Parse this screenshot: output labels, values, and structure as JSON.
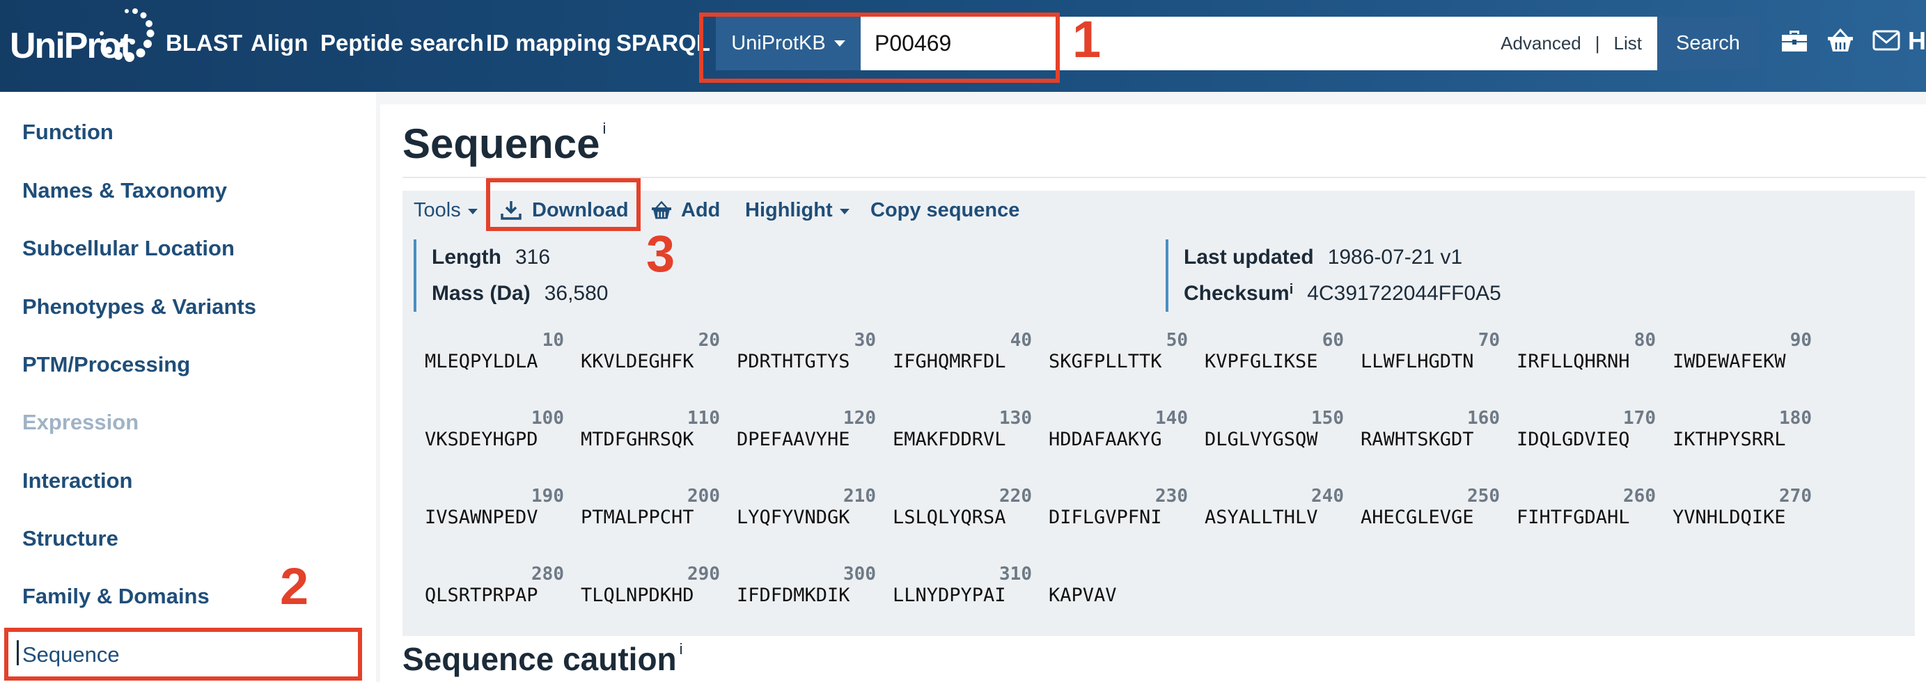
{
  "header": {
    "logo_text": "UniProt",
    "nav": [
      "BLAST",
      "Align",
      "Peptide search",
      "ID mapping",
      "SPARQL"
    ],
    "db_select": "UniProtKB",
    "search_value": "P00469",
    "advanced_label": "Advanced",
    "separator": "|",
    "list_label": "List",
    "search_button": "Search",
    "icons": [
      "toolbox-icon",
      "basket-icon",
      "mail-icon"
    ],
    "trailing_text": "H"
  },
  "sidebar": {
    "items": [
      {
        "label": "Function",
        "state": "normal"
      },
      {
        "label": "Names & Taxonomy",
        "state": "normal"
      },
      {
        "label": "Subcellular Location",
        "state": "normal"
      },
      {
        "label": "Phenotypes & Variants",
        "state": "normal"
      },
      {
        "label": "PTM/Processing",
        "state": "normal"
      },
      {
        "label": "Expression",
        "state": "disabled"
      },
      {
        "label": "Interaction",
        "state": "normal"
      },
      {
        "label": "Structure",
        "state": "normal"
      },
      {
        "label": "Family & Domains",
        "state": "normal"
      },
      {
        "label": "Sequence",
        "state": "active"
      }
    ]
  },
  "main": {
    "title": "Sequence",
    "title_sup": "i",
    "toolbar": {
      "tools": "Tools",
      "download": "Download",
      "add": "Add",
      "highlight": "Highlight",
      "copy": "Copy sequence"
    },
    "info_left": [
      {
        "label": "Length",
        "value": "316"
      },
      {
        "label": "Mass (Da)",
        "value": "36,580"
      }
    ],
    "info_right": [
      {
        "label": "Last updated",
        "sup": "",
        "value": "1986-07-21 v1"
      },
      {
        "label": "Checksum",
        "sup": "i",
        "value": "4C391722044FF0A5"
      }
    ],
    "sequence_chunks": [
      {
        "num": "10",
        "aa": "MLEQPYLDLA"
      },
      {
        "num": "20",
        "aa": "KKVLDEGHFK"
      },
      {
        "num": "30",
        "aa": "PDRTHTGTYS"
      },
      {
        "num": "40",
        "aa": "IFGHQMRFDL"
      },
      {
        "num": "50",
        "aa": "SKGFPLLTTK"
      },
      {
        "num": "60",
        "aa": "KVPFGLIKSE"
      },
      {
        "num": "70",
        "aa": "LLWFLHGDTN"
      },
      {
        "num": "80",
        "aa": "IRFLLQHRNH"
      },
      {
        "num": "90",
        "aa": "IWDEWAFEKW"
      },
      {
        "num": "100",
        "aa": "VKSDEYHGPD"
      },
      {
        "num": "110",
        "aa": "MTDFGHRSQK"
      },
      {
        "num": "120",
        "aa": "DPEFAAVYHE"
      },
      {
        "num": "130",
        "aa": "EMAKFDDRVL"
      },
      {
        "num": "140",
        "aa": "HDDAFAAKYG"
      },
      {
        "num": "150",
        "aa": "DLGLVYGSQW"
      },
      {
        "num": "160",
        "aa": "RAWHTSKGDT"
      },
      {
        "num": "170",
        "aa": "IDQLGDVIEQ"
      },
      {
        "num": "180",
        "aa": "IKTHPYSRRL"
      },
      {
        "num": "190",
        "aa": "IVSAWNPEDV"
      },
      {
        "num": "200",
        "aa": "PTMALPPCHT"
      },
      {
        "num": "210",
        "aa": "LYQFYVNDGK"
      },
      {
        "num": "220",
        "aa": "LSLQLYQRSA"
      },
      {
        "num": "230",
        "aa": "DIFLGVPFNI"
      },
      {
        "num": "240",
        "aa": "ASYALLTHLV"
      },
      {
        "num": "250",
        "aa": "AHECGLEVGE"
      },
      {
        "num": "260",
        "aa": "FIHTFGDAHL"
      },
      {
        "num": "270",
        "aa": "YVNHLDQIKE"
      },
      {
        "num": "280",
        "aa": "QLSRTPRPAP"
      },
      {
        "num": "290",
        "aa": "TLQLNPDKHD"
      },
      {
        "num": "300",
        "aa": "IFDFDMKDIK"
      },
      {
        "num": "310",
        "aa": "LLNYDPYPAI"
      },
      {
        "num": "",
        "aa": "KAPVAV"
      }
    ],
    "next_section": "Sequence caution",
    "next_section_sup": "i"
  },
  "annotations": {
    "labels": [
      "1",
      "2",
      "3"
    ],
    "color": "#e4412a"
  },
  "colors": {
    "header": "#1b4f7f",
    "link": "#1f4e79",
    "accent": "#2b5f91"
  }
}
